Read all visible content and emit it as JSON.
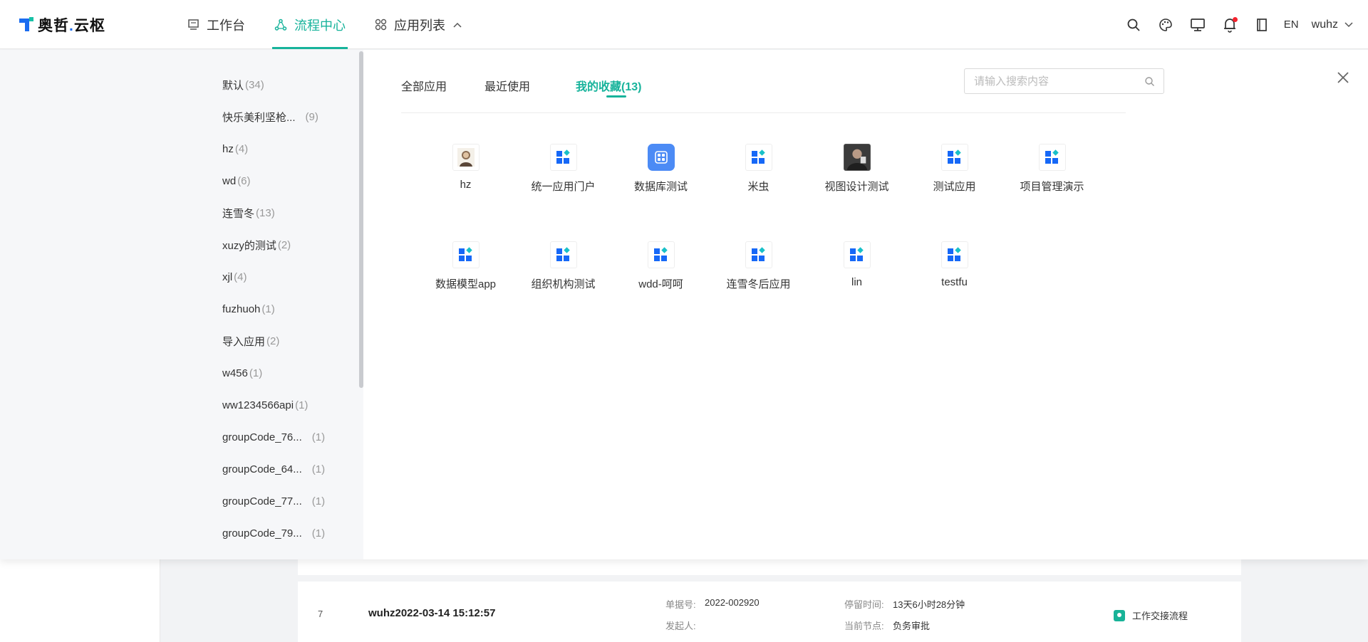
{
  "brand": {
    "name_left": "奥哲",
    "dot": ".",
    "name_right": "云枢"
  },
  "nav": [
    {
      "label": "工作台",
      "icon": "monitor-icon"
    },
    {
      "label": "流程中心",
      "icon": "flow-icon",
      "active": true
    },
    {
      "label": "应用列表",
      "icon": "apps-grid-icon",
      "caret": "chevron-up-icon"
    }
  ],
  "toolbar": {
    "icons": [
      "search-icon",
      "palette-icon",
      "screen-icon",
      "bell-icon",
      "book-icon"
    ],
    "lang": "EN",
    "user": "wuhz"
  },
  "categories": [
    {
      "name": "默认",
      "count": "(34)"
    },
    {
      "name": "快乐美利坚枪...",
      "count": "(9)"
    },
    {
      "name": "hz",
      "count": "(4)"
    },
    {
      "name": "wd",
      "count": "(6)"
    },
    {
      "name": "连雪冬",
      "count": "(13)"
    },
    {
      "name": "xuzy的测试",
      "count": "(2)"
    },
    {
      "name": "xjl",
      "count": "(4)"
    },
    {
      "name": "fuzhuoh",
      "count": "(1)"
    },
    {
      "name": "导入应用",
      "count": "(2)"
    },
    {
      "name": "w456",
      "count": "(1)"
    },
    {
      "name": "ww1234566api",
      "count": "(1)"
    },
    {
      "name": "groupCode_76...",
      "count": "(1)"
    },
    {
      "name": "groupCode_64...",
      "count": "(1)"
    },
    {
      "name": "groupCode_77...",
      "count": "(1)"
    },
    {
      "name": "groupCode_79...",
      "count": "(1)"
    }
  ],
  "tabs": {
    "all": "全部应用",
    "recent": "最近使用",
    "favorites": "我的收藏(13)"
  },
  "search": {
    "placeholder": "请输入搜索内容"
  },
  "apps": [
    {
      "name": "hz",
      "icon": "portrait-icon"
    },
    {
      "name": "统一应用门户",
      "icon": "app-grid-icon"
    },
    {
      "name": "数据库测试",
      "icon": "database-app-icon"
    },
    {
      "name": "米虫",
      "icon": "app-grid-icon"
    },
    {
      "name": "视图设计测试",
      "icon": "photo-icon"
    },
    {
      "name": "测试应用",
      "icon": "app-grid-icon"
    },
    {
      "name": "项目管理演示",
      "icon": "app-grid-icon"
    },
    {
      "name": "数据模型app",
      "icon": "app-grid-icon"
    },
    {
      "name": "组织机构测试",
      "icon": "app-grid-icon"
    },
    {
      "name": "wdd-呵呵",
      "icon": "app-grid-icon"
    },
    {
      "name": "连雪冬后应用",
      "icon": "app-grid-icon"
    },
    {
      "name": "lin",
      "icon": "app-grid-icon"
    },
    {
      "name": "testfu",
      "icon": "app-grid-icon"
    }
  ],
  "background_row": {
    "index": "7",
    "title": "wuhz2022-03-14 15:12:57",
    "doc_label": "单据号:",
    "doc_value": "2022-002920",
    "stay_label": "停留时间:",
    "stay_value": "13天6小时28分钟",
    "initiator_label": "发起人:",
    "node_label": "当前节点:",
    "node_value": "负务审批",
    "workflow": "工作交接流程"
  },
  "colors": {
    "accent": "#17b39b",
    "brand_blue": "#1a6cf0",
    "app_blue": "#1668f7",
    "app_cyan": "#18c0c8"
  }
}
